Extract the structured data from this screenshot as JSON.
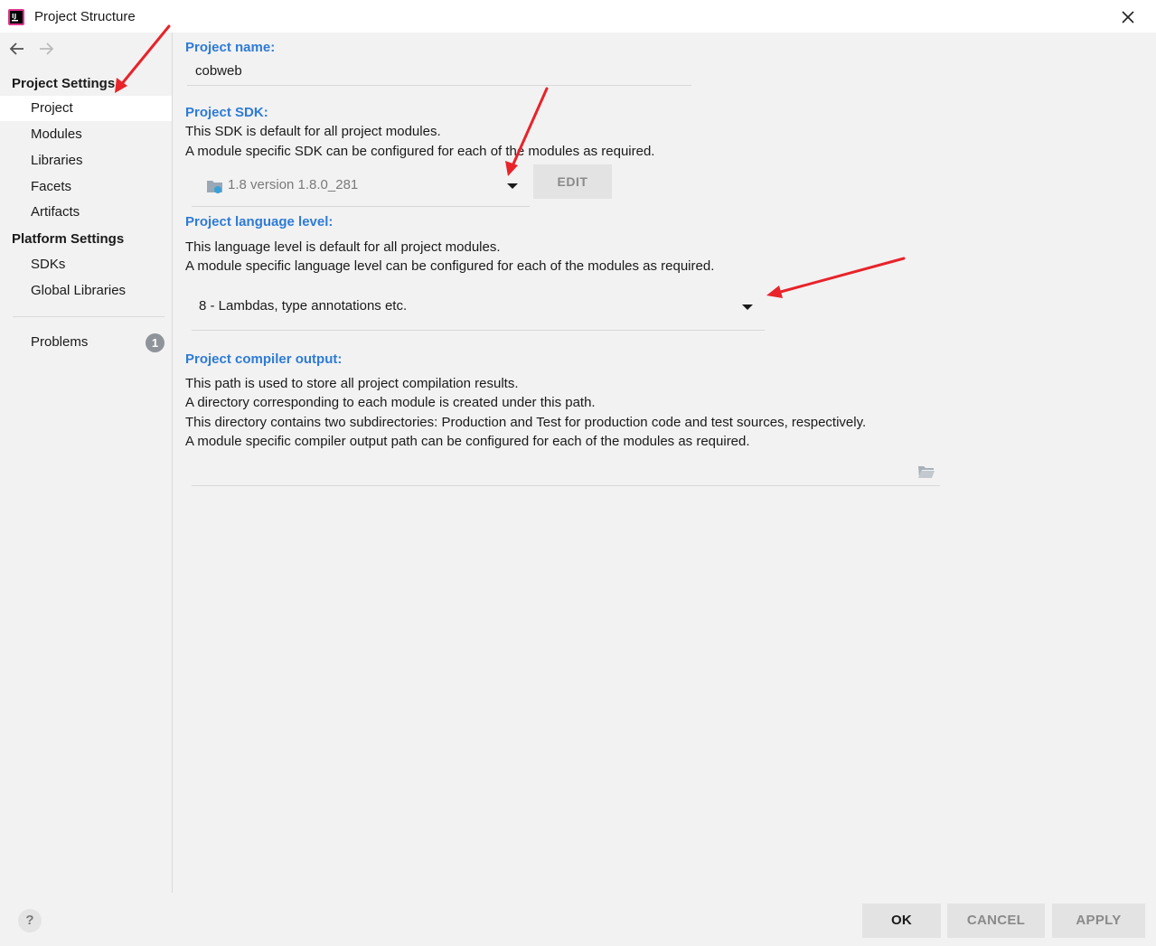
{
  "window": {
    "title": "Project Structure"
  },
  "sidebar": {
    "project_settings_header": "Project Settings",
    "project_items": [
      "Project",
      "Modules",
      "Libraries",
      "Facets",
      "Artifacts"
    ],
    "selected": "Project",
    "platform_settings_header": "Platform Settings",
    "platform_items": [
      "SDKs",
      "Global Libraries"
    ],
    "problems_label": "Problems",
    "problems_count": "1"
  },
  "main": {
    "project_name": {
      "title": "Project name:",
      "value": "cobweb"
    },
    "project_sdk": {
      "title": "Project SDK:",
      "desc1": "This SDK is default for all project modules.",
      "desc2": "A module specific SDK can be configured for each of the modules as required.",
      "selected": "1.8 version 1.8.0_281",
      "edit_label": "EDIT"
    },
    "language_level": {
      "title": "Project language level:",
      "desc1": "This language level is default for all project modules.",
      "desc2": "A module specific language level can be configured for each of the modules as required.",
      "selected": "8 - Lambdas, type annotations etc."
    },
    "compiler_output": {
      "title": "Project compiler output:",
      "desc1": "This path is used to store all project compilation results.",
      "desc2": "A directory corresponding to each module is created under this path.",
      "desc3": "This directory contains two subdirectories: Production and Test for production code and test sources, respectively.",
      "desc4": "A module specific compiler output path can be configured for each of the modules as required.",
      "value": ""
    }
  },
  "footer": {
    "help": "?",
    "ok": "OK",
    "cancel": "CANCEL",
    "apply": "APPLY"
  },
  "colors": {
    "accent": "#2e7bd6",
    "annotation_arrow": "#e8232a",
    "selected_item_bg": "#ffffff",
    "panel_bg": "#f2f2f2"
  }
}
